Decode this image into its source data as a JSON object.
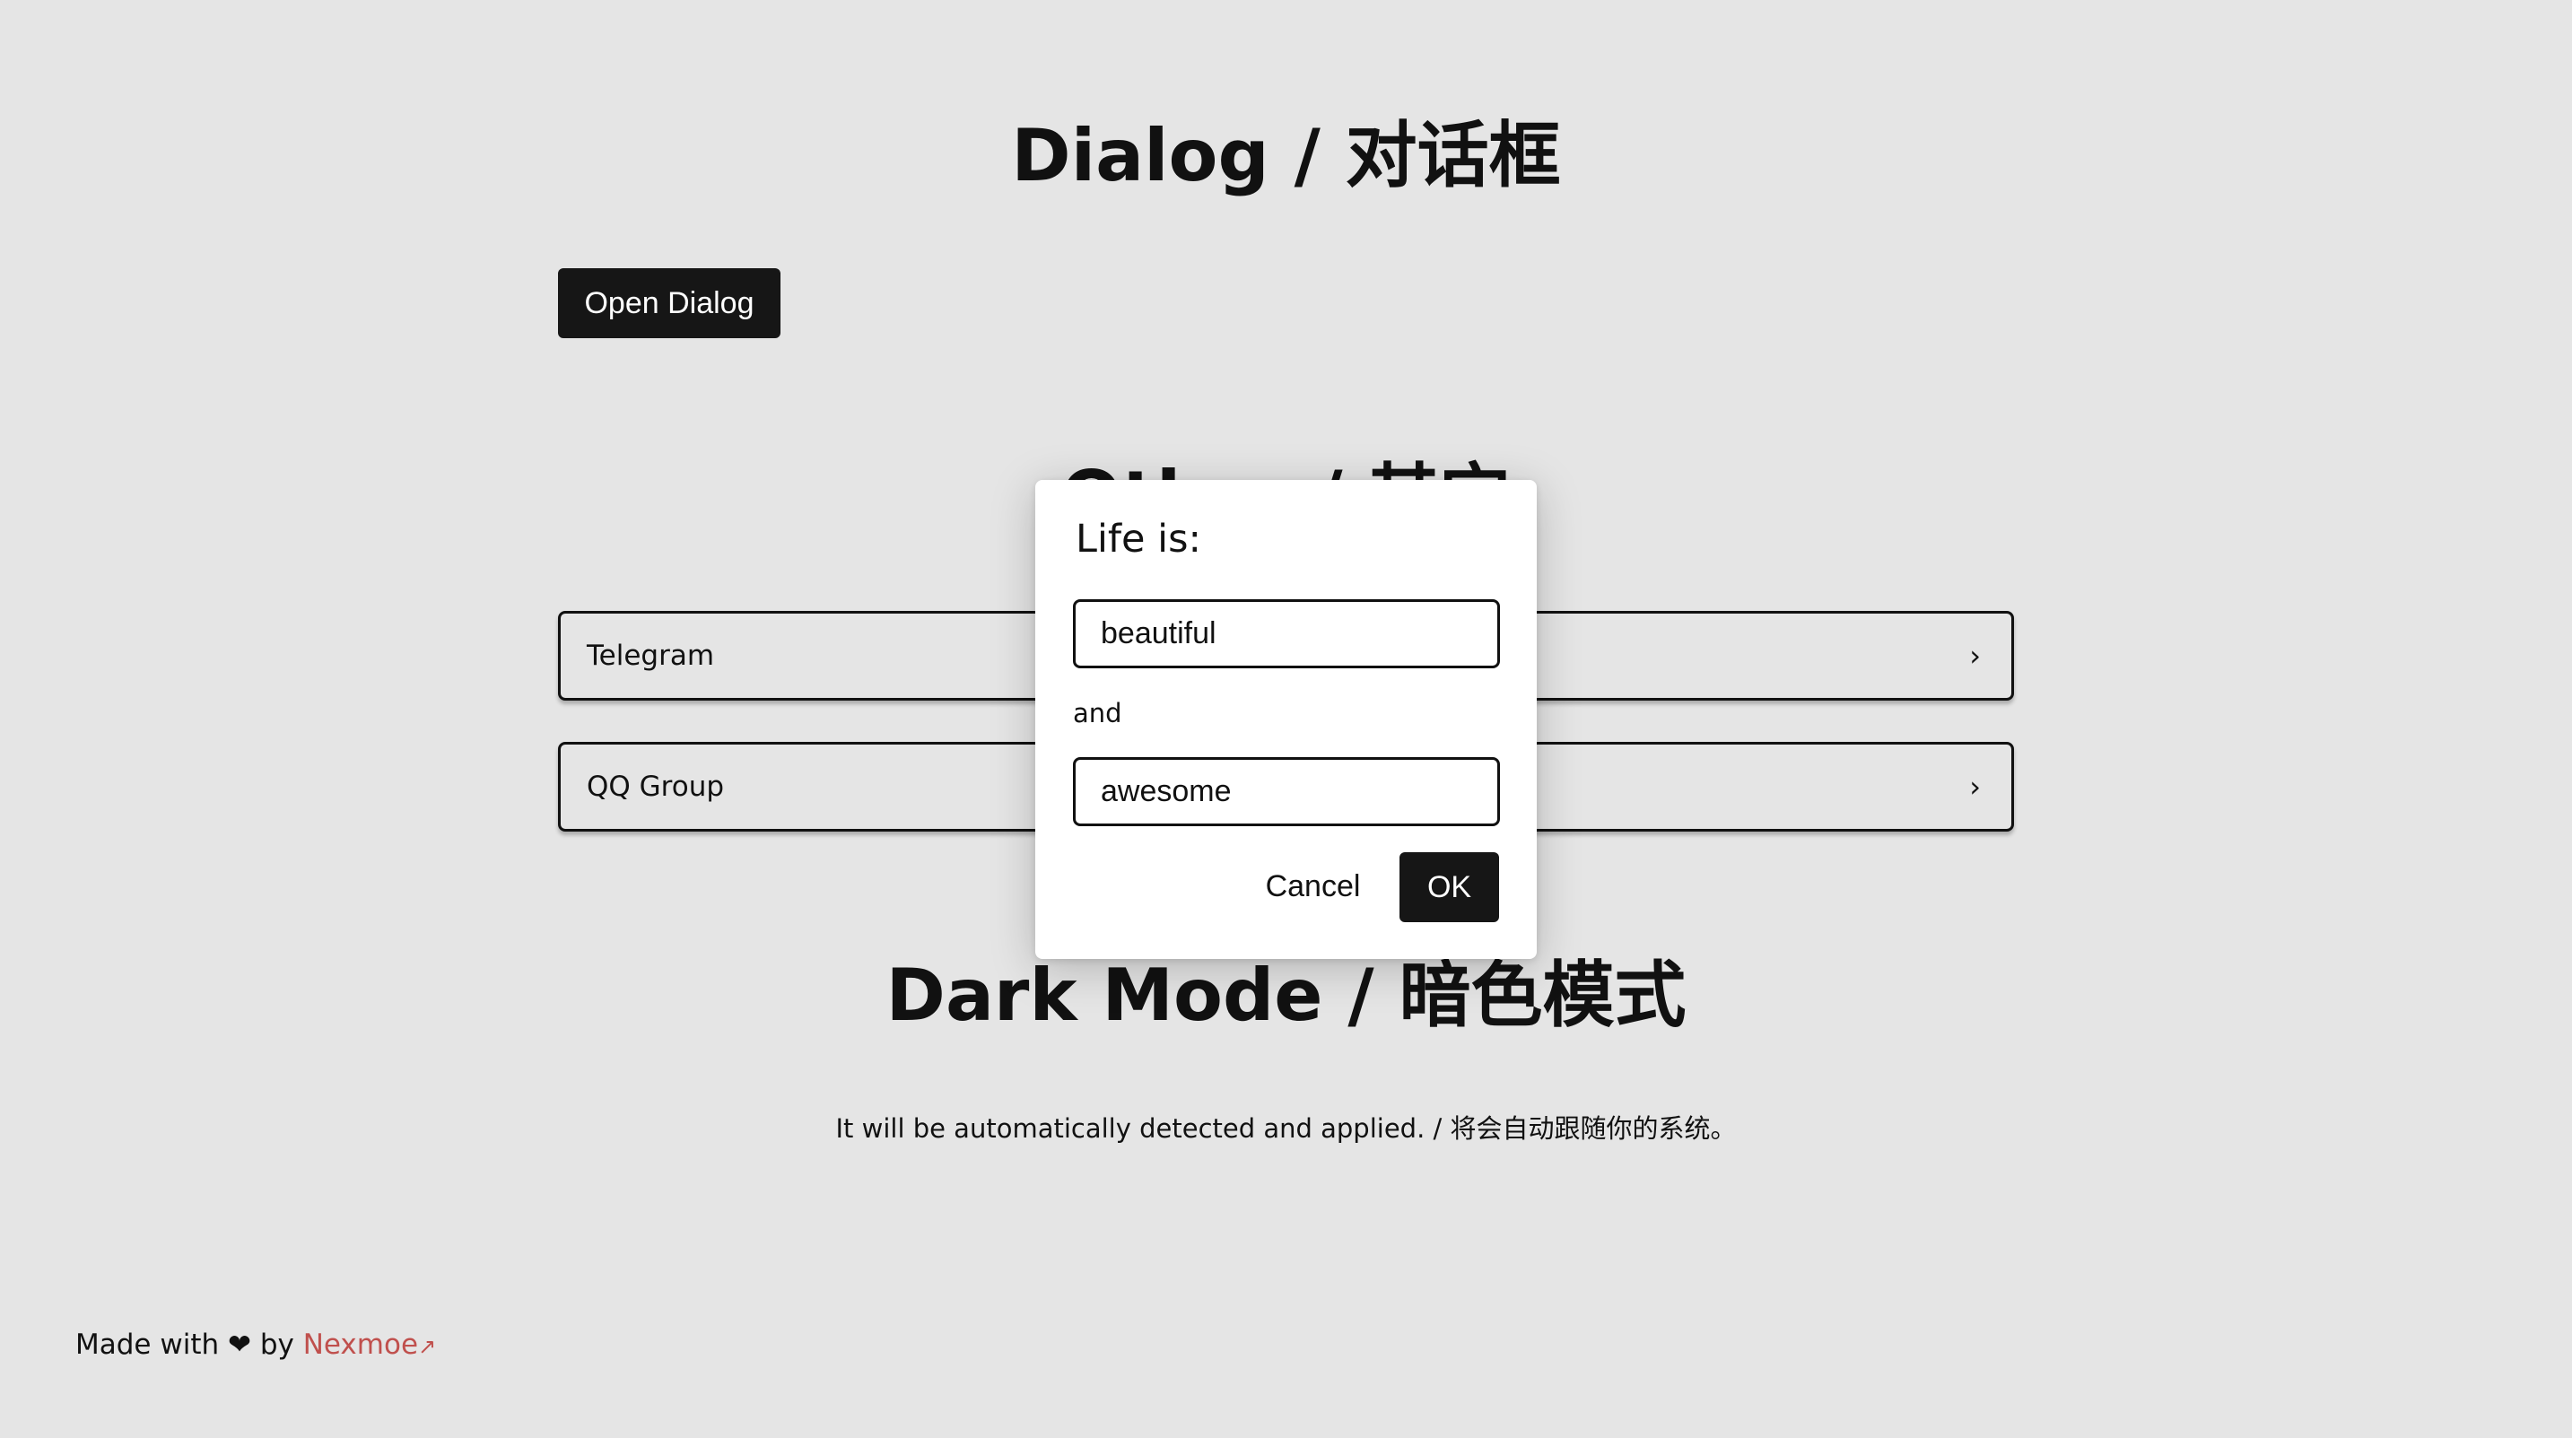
{
  "sections": {
    "dialog_title": "Dialog / 对话框",
    "other_title": "Other / 其它",
    "dark_title": "Dark Mode / 暗色模式",
    "dark_description": "It will be automatically detected and applied. / 将会自动跟随你的系统。"
  },
  "open_dialog_button": "Open Dialog",
  "links": [
    {
      "label": "Telegram",
      "chevron": "›"
    },
    {
      "label": "QQ Group",
      "chevron": "›"
    }
  ],
  "dialog": {
    "title": "Life is:",
    "input1_value": "beautiful",
    "connector": "and",
    "input2_value": "awesome",
    "cancel_label": "Cancel",
    "ok_label": "OK"
  },
  "footer": {
    "prefix": "Made with",
    "heart": "❤",
    "by": "by",
    "author": "Nexmoe",
    "external_icon": "↗"
  },
  "colors": {
    "background": "#e5e5e5",
    "primary_button": "#161616",
    "link_accent": "#c0504d",
    "dialog_surface": "#ffffff"
  }
}
